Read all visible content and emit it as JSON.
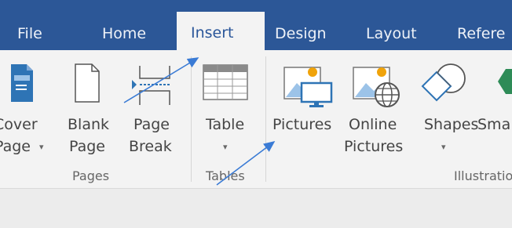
{
  "tabs": [
    {
      "id": "file",
      "label": "File"
    },
    {
      "id": "home",
      "label": "Home"
    },
    {
      "id": "insert",
      "label": "Insert",
      "active": true
    },
    {
      "id": "design",
      "label": "Design"
    },
    {
      "id": "layout",
      "label": "Layout"
    },
    {
      "id": "references",
      "label": "Refere"
    }
  ],
  "groups": {
    "pages": {
      "label": "Pages",
      "buttons": {
        "cover_page": {
          "line1": "Cover",
          "line2": "Page",
          "icon": "cover-page-icon",
          "has_dropdown": true
        },
        "blank_page": {
          "line1": "Blank",
          "line2": "Page",
          "icon": "blank-page-icon"
        },
        "page_break": {
          "line1": "Page",
          "line2": "Break",
          "icon": "page-break-icon"
        }
      }
    },
    "tables": {
      "label": "Tables",
      "buttons": {
        "table": {
          "line1": "Table",
          "icon": "table-icon",
          "has_dropdown": true
        }
      }
    },
    "illustrations": {
      "label": "Illustratio",
      "buttons": {
        "pictures": {
          "line1": "Pictures",
          "icon": "pictures-icon"
        },
        "online_pictures": {
          "line1": "Online",
          "line2": "Pictures",
          "icon": "online-pictures-icon"
        },
        "shapes": {
          "line1": "Shapes",
          "icon": "shapes-icon",
          "has_dropdown": true
        },
        "smartart": {
          "line1": "Sma",
          "icon": "smartart-icon"
        }
      }
    }
  },
  "colors": {
    "tab_bar": "#2c5797",
    "ribbon": "#f3f3f3",
    "annotation_arrow": "#3a7bd5",
    "icon_blue": "#2e74b5",
    "icon_orange": "#f0a30a",
    "icon_green": "#2e8b57"
  },
  "annotations": {
    "arrows": [
      "points-to-insert-tab",
      "points-to-pictures-button"
    ]
  }
}
